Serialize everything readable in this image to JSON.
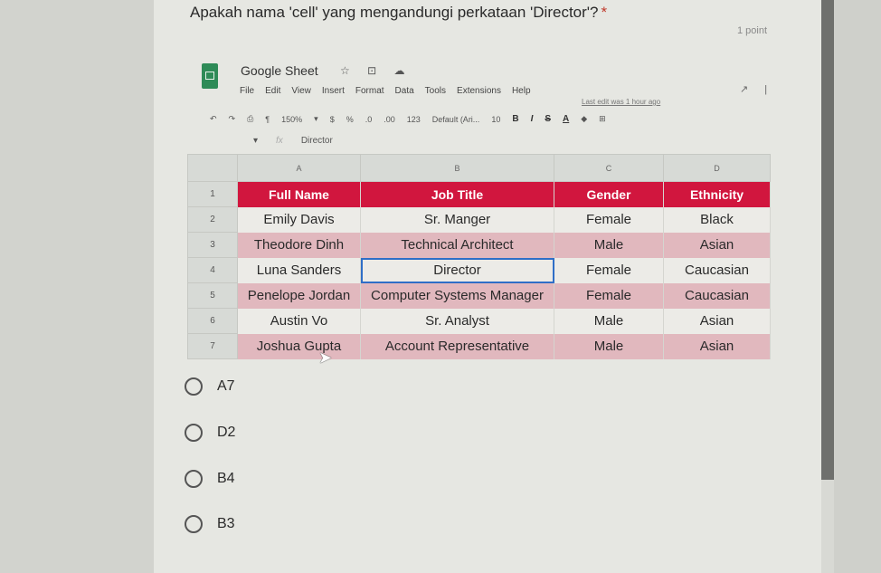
{
  "question": {
    "text": "Apakah nama 'cell' yang mengandungi perkataan 'Director'?",
    "required_mark": "*",
    "points": "1 point"
  },
  "sheet": {
    "title": "Google Sheet",
    "title_icons": "☆ ⊡ ☁",
    "menu": [
      "File",
      "Edit",
      "View",
      "Insert",
      "Format",
      "Data",
      "Tools",
      "Extensions",
      "Help"
    ],
    "last_edit": "Last edit was 1 hour ago",
    "toolbar": {
      "zoom": "150%",
      "currency": "$",
      "percent": "%",
      "dec_dec": ".0",
      "dec_inc": ".00",
      "format": "123",
      "font": "Default (Ari...",
      "font_size": "10",
      "bold": "B",
      "italic": "I",
      "strike": "S",
      "text_color": "A"
    },
    "formula_bar": {
      "fx": "fx",
      "value": "Director"
    },
    "columns": [
      "A",
      "B",
      "C",
      "D"
    ],
    "rows": [
      {
        "num": "1",
        "cells": [
          "Full Name",
          "Job Title",
          "Gender",
          "Ethnicity"
        ]
      },
      {
        "num": "2",
        "cells": [
          "Emily Davis",
          "Sr. Manger",
          "Female",
          "Black"
        ]
      },
      {
        "num": "3",
        "cells": [
          "Theodore Dinh",
          "Technical Architect",
          "Male",
          "Asian"
        ]
      },
      {
        "num": "4",
        "cells": [
          "Luna Sanders",
          "Director",
          "Female",
          "Caucasian"
        ]
      },
      {
        "num": "5",
        "cells": [
          "Penelope Jordan",
          "Computer Systems Manager",
          "Female",
          "Caucasian"
        ]
      },
      {
        "num": "6",
        "cells": [
          "Austin Vo",
          "Sr. Analyst",
          "Male",
          "Asian"
        ]
      },
      {
        "num": "7",
        "cells": [
          "Joshua Gupta",
          "Account Representative",
          "Male",
          "Asian"
        ]
      }
    ],
    "colors": {
      "header_fill": "#d1163e",
      "alt_row_fill": "#e1b8be",
      "selection": "#2f6ec7"
    }
  },
  "options": [
    "A7",
    "D2",
    "B4",
    "B3"
  ]
}
